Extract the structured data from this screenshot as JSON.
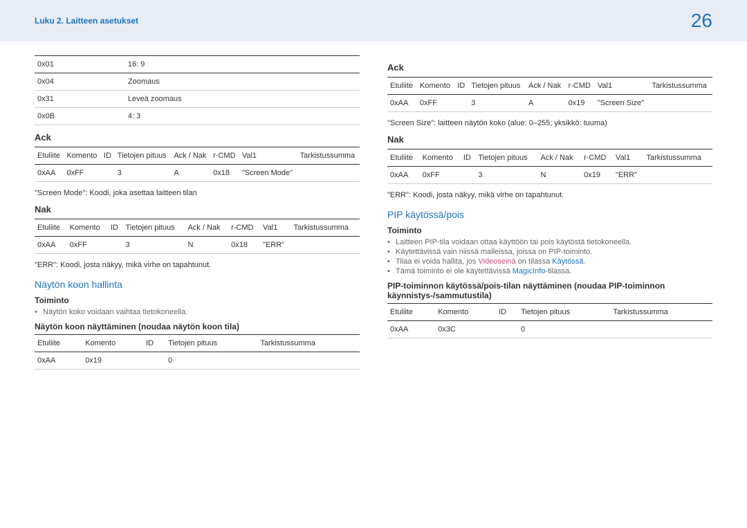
{
  "header": {
    "breadcrumb": "Luku 2. Laitteen asetukset",
    "page_number": "26"
  },
  "left": {
    "codes_table": {
      "rows": [
        [
          "0x01",
          "16: 9"
        ],
        [
          "0x04",
          "Zoomaus"
        ],
        [
          "0x31",
          "Leveä zoomaus"
        ],
        [
          "0x0B",
          "4: 3"
        ]
      ]
    },
    "ack_heading": "Ack",
    "ack_table": {
      "headers": [
        "Etuliite",
        "Komento",
        "ID",
        "Tietojen pituus",
        "Ack / Nak",
        "r-CMD",
        "Val1",
        "Tarkistussumma"
      ],
      "row": [
        "0xAA",
        "0xFF",
        "",
        "3",
        "A",
        "0x18",
        "\"Screen Mode\"",
        ""
      ]
    },
    "ack_note": "\"Screen Mode\": Koodi, joka asettaa laitteen tilan",
    "nak_heading": "Nak",
    "nak_table": {
      "headers": [
        "Etuliite",
        "Komento",
        "ID",
        "Tietojen pituus",
        "Ack / Nak",
        "r-CMD",
        "Val1",
        "Tarkistussumma"
      ],
      "row": [
        "0xAA",
        "0xFF",
        "",
        "3",
        "N",
        "0x18",
        "\"ERR\"",
        ""
      ]
    },
    "nak_note": "\"ERR\": Koodi, josta näkyy, mikä virhe on tapahtunut.",
    "section_heading": "Näytön koon hallinta",
    "toiminto_heading": "Toiminto",
    "toiminto_bullets": [
      "Näytön koko voidaan vaihtaa tietokoneella."
    ],
    "sub_heading": "Näytön koon näyttäminen (noudaa näytön koon tila)",
    "cmd_table": {
      "headers": [
        "Etuliite",
        "Komento",
        "ID",
        "Tietojen pituus",
        "Tarkistussumma"
      ],
      "row": [
        "0xAA",
        "0x19",
        "",
        "0",
        ""
      ]
    }
  },
  "right": {
    "ack_heading": "Ack",
    "ack_table": {
      "headers": [
        "Etuliite",
        "Komento",
        "ID",
        "Tietojen pituus",
        "Ack / Nak",
        "r-CMD",
        "Val1",
        "Tarkistussumma"
      ],
      "row": [
        "0xAA",
        "0xFF",
        "",
        "3",
        "A",
        "0x19",
        "\"Screen Size\"",
        ""
      ]
    },
    "ack_note": "\"Screen Size\": laitteen näytön koko (alue: 0–255; yksikkö: tuuma)",
    "nak_heading": "Nak",
    "nak_table": {
      "headers": [
        "Etuliite",
        "Komento",
        "ID",
        "Tietojen pituus",
        "Ack / Nak",
        "r-CMD",
        "Val1",
        "Tarkistussumma"
      ],
      "row": [
        "0xAA",
        "0xFF",
        "",
        "3",
        "N",
        "0x19",
        "\"ERR\"",
        ""
      ]
    },
    "nak_note": "\"ERR\": Koodi, josta näkyy, mikä virhe on tapahtunut.",
    "section_heading": "PIP käytössä/pois",
    "toiminto_heading": "Toiminto",
    "toiminto_bullets": [
      "Laitteen PIP-tila voidaan ottaa käyttöön tai pois käytöstä tietokoneella.",
      "Käytettävissä vain niissä malleissa, joissa on PIP-toiminto."
    ],
    "bullet3_pre": "Tilaa ei voida hallita, jos ",
    "bullet3_link1": "Videoseinä",
    "bullet3_mid": " on tilassa ",
    "bullet3_link2": "Käytössä",
    "bullet3_post": ".",
    "bullet4_pre": "Tämä toiminto ei ole käytettävissä ",
    "bullet4_link": "MagicInfo",
    "bullet4_post": "-tilassa.",
    "sub_heading": "PIP-toiminnon käytössä/pois-tilan näyttäminen (noudaa PIP-toiminnon käynnistys-/sammutustila)",
    "cmd_table": {
      "headers": [
        "Etuliite",
        "Komento",
        "ID",
        "Tietojen pituus",
        "Tarkistussumma"
      ],
      "row": [
        "0xAA",
        "0x3C",
        "",
        "0",
        ""
      ]
    }
  }
}
